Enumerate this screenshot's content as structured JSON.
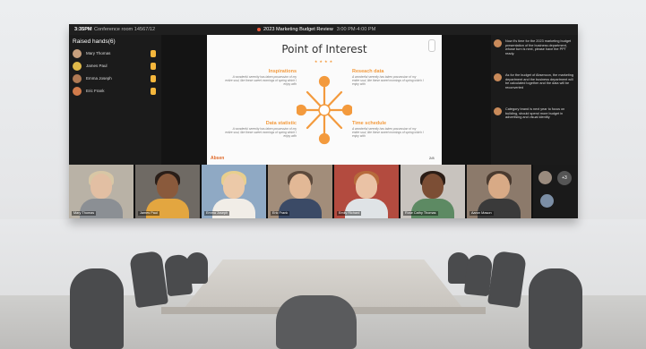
{
  "meeting": {
    "time": "3:35PM",
    "room": "Conference room 14567/12",
    "title": "2023 Marketing Budget Review",
    "hours": "3:00 PM-4:00 PM"
  },
  "raised_hands": {
    "title": "Raised hands(6)",
    "people": [
      {
        "name": "Mary Thomas",
        "avatar_color": "#c8a07e"
      },
      {
        "name": "James Paul",
        "avatar_color": "#e0b94a"
      },
      {
        "name": "Emma Joseph",
        "avatar_color": "#b07a54"
      },
      {
        "name": "Eric Frank",
        "avatar_color": "#d17b4b"
      }
    ]
  },
  "slide": {
    "title": "Point of Interest",
    "blocks": [
      {
        "heading": "Inspirations",
        "body": "A wonderful serenity has taken possession of my entire soul, like these sweet mornings of spring which I enjoy with"
      },
      {
        "heading": "Reseach data",
        "body": "A wonderful serenity has taken possession of my entire soul, like these sweet mornings of spring which I enjoy with"
      },
      {
        "heading": "Data statistic",
        "body": "A wonderful serenity has taken possession of my entire soul, like these sweet mornings of spring which I enjoy with"
      },
      {
        "heading": "Time schedule",
        "body": "A wonderful serenity has taken possession of my entire soul, like these sweet mornings of spring which I enjoy with"
      }
    ],
    "logo": "Absen",
    "page": "2/8",
    "accent": "#f39a3d"
  },
  "chat": {
    "messages": [
      {
        "text": "Now it's time for the 2023 marketing budget presentation of the business department, whose turn is next, please have the PPT ready."
      },
      {
        "text": "As for the budget of Absencon, the marketing department and the business department will be calculated together and the data will be reconverted"
      },
      {
        "text": "Category brand is next year to focus on building, should spend more budget in advertising and visual identity"
      }
    ]
  },
  "participants": [
    {
      "name": "Mary Thomas",
      "bg": "#b9b2a6",
      "skin": "#e2bfa3",
      "hair": "#d8c7a5",
      "shirt": "#8b8f94"
    },
    {
      "name": "James Paul",
      "bg": "#6f6a64",
      "skin": "#8a5a3c",
      "hair": "#2a1e18",
      "shirt": "#e3a640"
    },
    {
      "name": "Emma Joseph",
      "bg": "#8fa9c4",
      "skin": "#ecc9a8",
      "hair": "#e8cf8e",
      "shirt": "#f1ede7"
    },
    {
      "name": "Eric Frank",
      "bg": "#a28d7a",
      "skin": "#e2b896",
      "hair": "#5d4a3c",
      "shirt": "#3b4a66"
    },
    {
      "name": "Emily Richard",
      "bg": "#b34b3f",
      "skin": "#eac2a5",
      "hair": "#b76a3b",
      "shirt": "#dfe3e6"
    },
    {
      "name": "Rose Cathy Thomas",
      "bg": "#c8c3be",
      "skin": "#7c4e35",
      "hair": "#2b1d16",
      "shirt": "#5d8a63"
    },
    {
      "name": "Aaron Mason",
      "bg": "#8c7a6b",
      "skin": "#d8aa86",
      "hair": "#4a3a2f",
      "shirt": "#3a3a3a"
    }
  ],
  "more_count": "+3"
}
